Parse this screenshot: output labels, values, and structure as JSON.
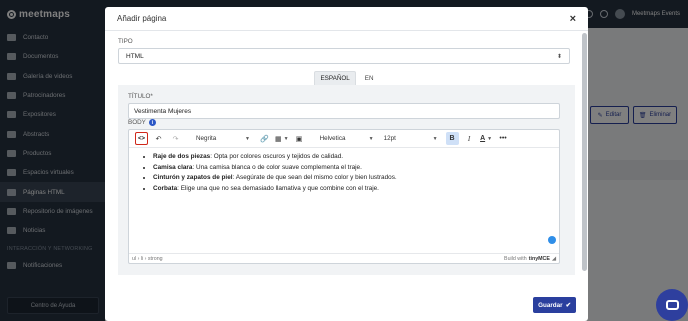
{
  "app": {
    "logo_text": "meetmaps"
  },
  "sidebar": {
    "items": [
      {
        "label": "Contacto",
        "icon": "chat-icon"
      },
      {
        "label": "Documentos",
        "icon": "document-icon"
      },
      {
        "label": "Galería de videos",
        "icon": "video-icon"
      },
      {
        "label": "Patrocinadores",
        "icon": "flag-icon"
      },
      {
        "label": "Expositores",
        "icon": "store-icon"
      },
      {
        "label": "Abstracts",
        "icon": "abstract-icon"
      },
      {
        "label": "Productos",
        "icon": "product-icon"
      },
      {
        "label": "Espacios virtuales",
        "icon": "space-icon"
      },
      {
        "label": "Páginas HTML",
        "icon": "html-icon",
        "active": true
      },
      {
        "label": "Repositorio de imágenes",
        "icon": "image-icon"
      },
      {
        "label": "Noticias",
        "icon": "news-icon"
      }
    ],
    "section_label": "INTERACCIÓN Y NETWORKING",
    "section_items": [
      {
        "label": "Notificaciones",
        "icon": "bell-icon"
      }
    ],
    "help_button": "Centro de Ayuda"
  },
  "topbar": {
    "user_name": "Meetmaps Events"
  },
  "background": {
    "edit_label": "Editar",
    "delete_label": "Eliminar"
  },
  "modal": {
    "title": "Añadir página",
    "close": "×",
    "tipo_label": "TIPO",
    "tipo_value": "HTML",
    "lang_tabs": [
      "ESPAÑOL",
      "EN"
    ],
    "title_label": "TÍTULO*",
    "title_value": "Vestimenta Mujeres",
    "body_label": "BODY",
    "editor": {
      "toolbar": {
        "code": "<>",
        "format_select": "Negrita",
        "font_select": "Helvetica",
        "size_select": "12pt",
        "bold": "B",
        "italic": "I",
        "text_color": "A",
        "more": "•••"
      },
      "items": [
        {
          "bold": "Raje de dos piezas",
          "text": ": Opta por colores oscuros y tejidos de calidad."
        },
        {
          "bold": "Camisa clara",
          "text": ": Una camisa blanca o de color suave complementa el traje."
        },
        {
          "bold": "Cinturón y zapatos de piel",
          "text": ": Asegúrate de que sean del mismo color y bien lustrados."
        },
        {
          "bold": "Corbata",
          "text": ": Elige una que no sea demasiado llamativa y que combine con el traje."
        }
      ],
      "path": "ul › li › strong",
      "build_with": "Build with",
      "brand": "tinyMCE"
    },
    "save_label": "Guardar"
  },
  "colors": {
    "primary": "#2a3f9e",
    "sidebar_bg": "#263241",
    "highlight_red": "#d0281a",
    "info_blue": "#2a56c6"
  }
}
